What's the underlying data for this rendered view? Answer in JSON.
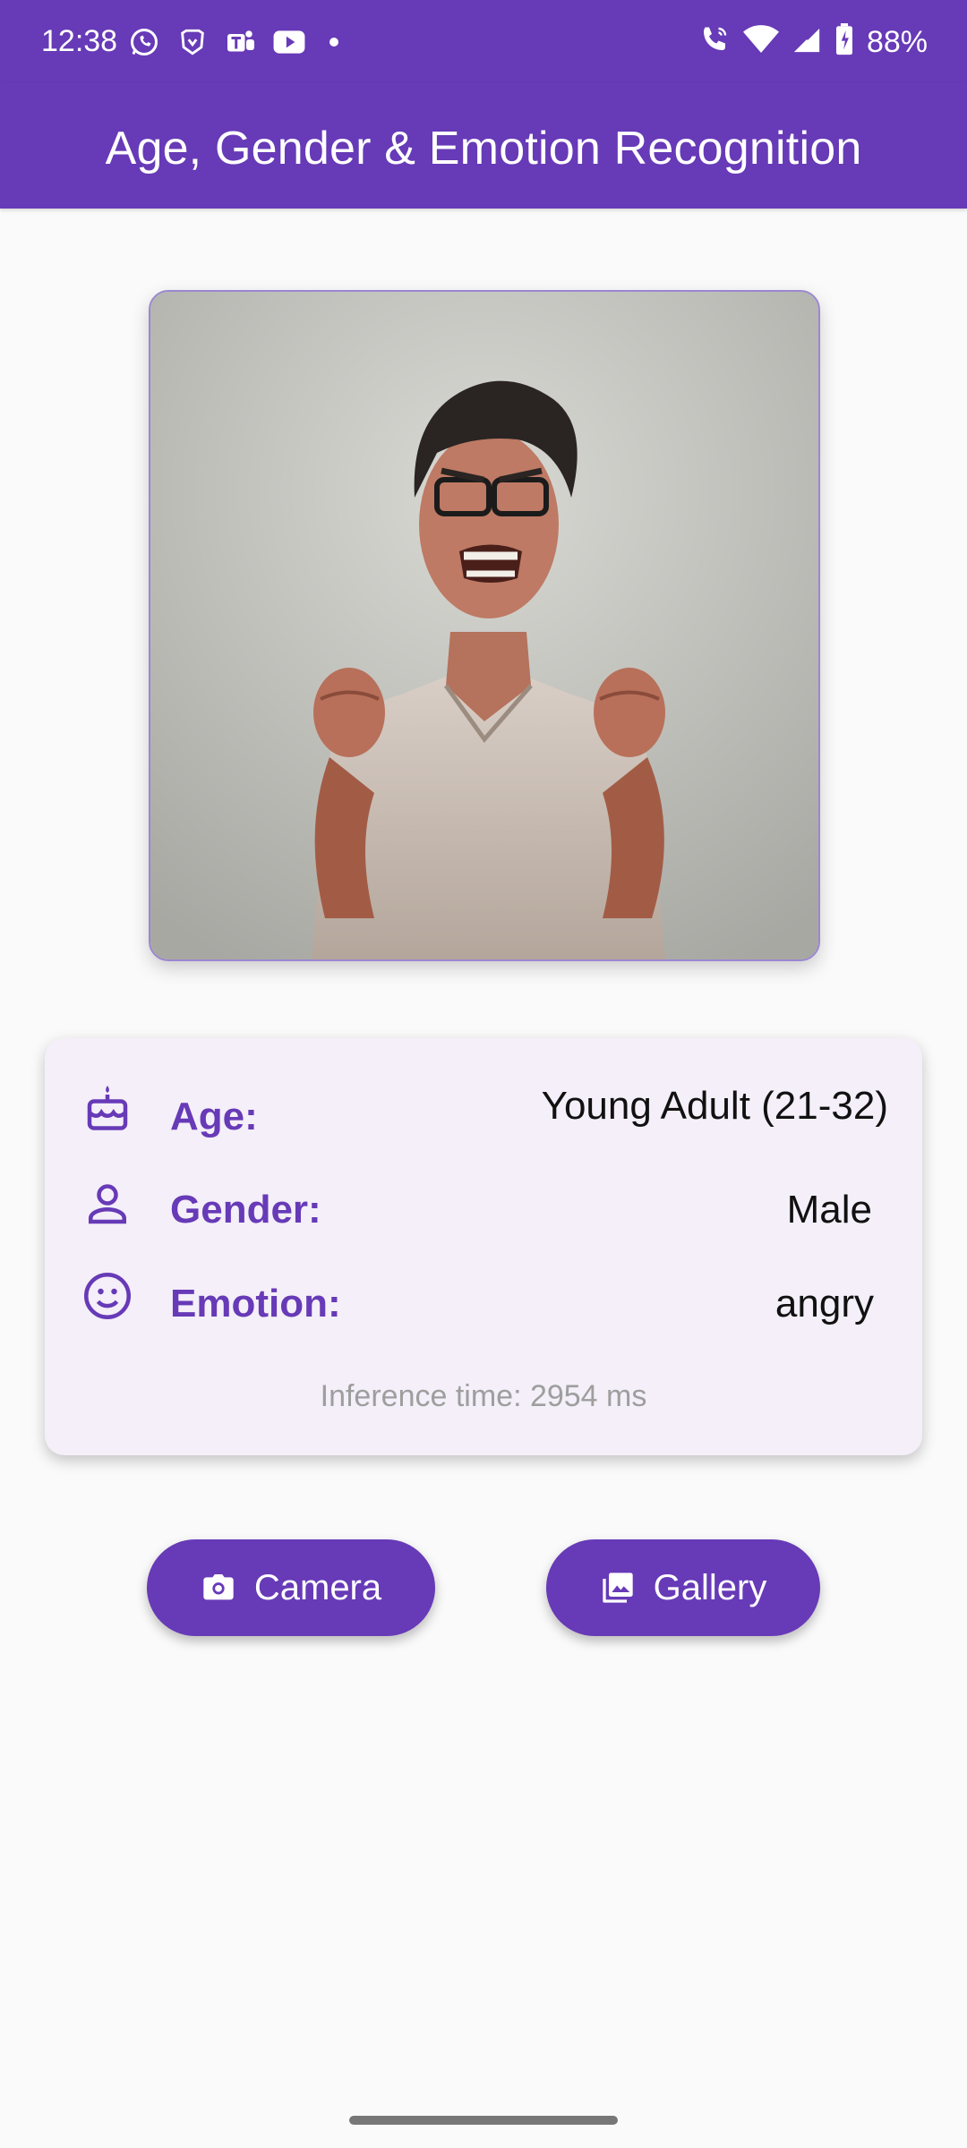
{
  "status_bar": {
    "time": "12:38",
    "left_icons": [
      "whatsapp-icon",
      "brave-icon",
      "teams-icon",
      "youtube-icon"
    ],
    "right_icons": [
      "wifi-calling-icon",
      "wifi-icon",
      "signal-icon",
      "battery-icon"
    ],
    "battery": "88%"
  },
  "app_bar": {
    "title": "Age, Gender & Emotion Recognition",
    "color": "#673ab7"
  },
  "photo": {
    "description_icon": "face-photo"
  },
  "results": {
    "age": {
      "icon": "cake-icon",
      "label": "Age:",
      "value": "Young Adult (21-32)"
    },
    "gender": {
      "icon": "person-icon",
      "label": "Gender:",
      "value": "Male"
    },
    "emotion": {
      "icon": "smiley-icon",
      "label": "Emotion:",
      "value": "angry"
    },
    "inference": "Inference time: 2954 ms"
  },
  "buttons": {
    "camera": {
      "icon": "camera-icon",
      "label": "Camera"
    },
    "gallery": {
      "icon": "gallery-icon",
      "label": "Gallery"
    }
  }
}
